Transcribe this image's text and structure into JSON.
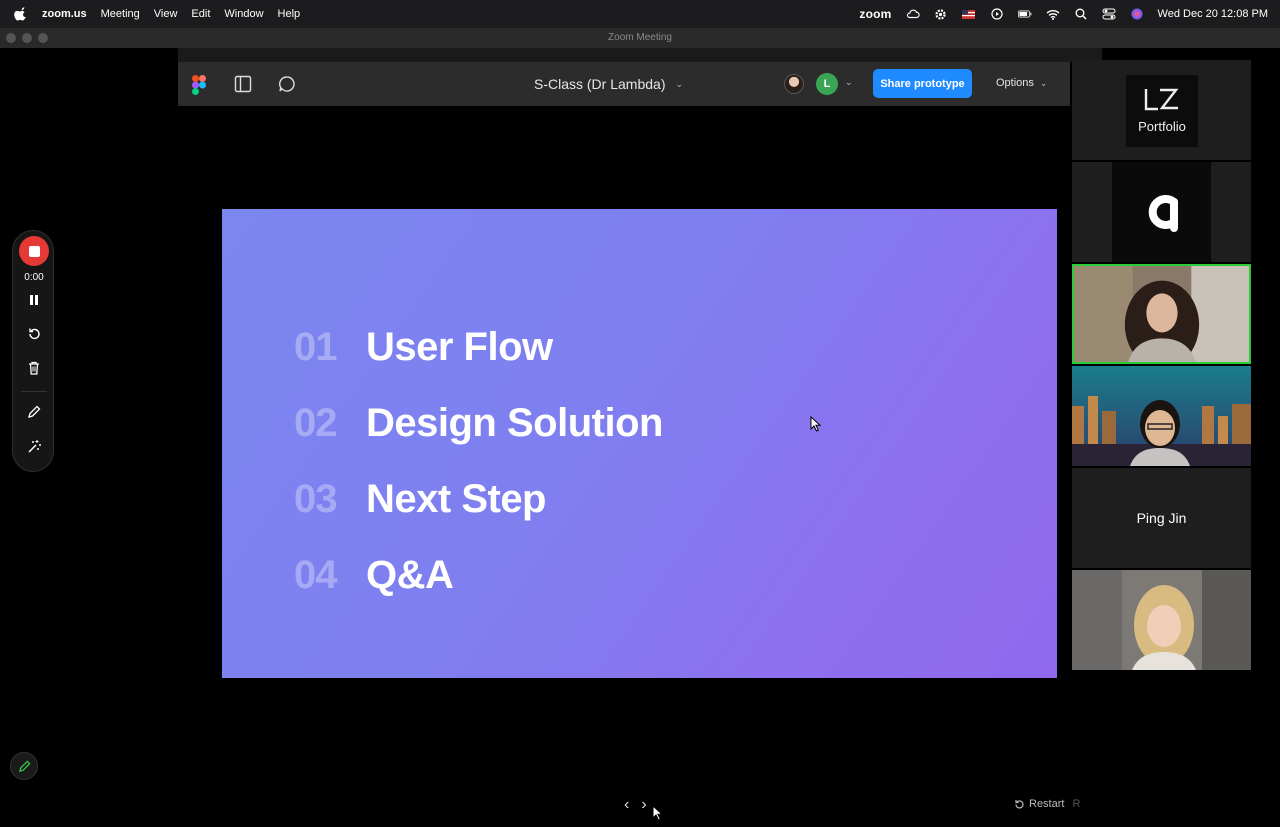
{
  "menubar": {
    "app_name": "zoom.us",
    "menus": [
      "Meeting",
      "View",
      "Edit",
      "Window",
      "Help"
    ],
    "zoom_word": "zoom",
    "datetime": "Wed Dec 20  12:08 PM"
  },
  "window": {
    "title": "Zoom Meeting"
  },
  "figma": {
    "file_title": "S-Class (Dr Lambda)",
    "avatar_initial": "L",
    "share_button": "Share prototype",
    "options_label": "Options",
    "restart_label": "Restart",
    "restart_key": "R"
  },
  "slide": {
    "items": [
      {
        "num": "01",
        "label": "User Flow"
      },
      {
        "num": "02",
        "label": "Design Solution"
      },
      {
        "num": "03",
        "label": "Next Step"
      },
      {
        "num": "04",
        "label": "Q&A"
      }
    ]
  },
  "recording": {
    "time": "0:00"
  },
  "gallery": {
    "lz_label": "Portfolio",
    "name_tile": "Ping Jin"
  },
  "colors": {
    "accent_blue": "#1f8bff",
    "active_speaker": "#2ccb3a",
    "record_red": "#e53935"
  }
}
